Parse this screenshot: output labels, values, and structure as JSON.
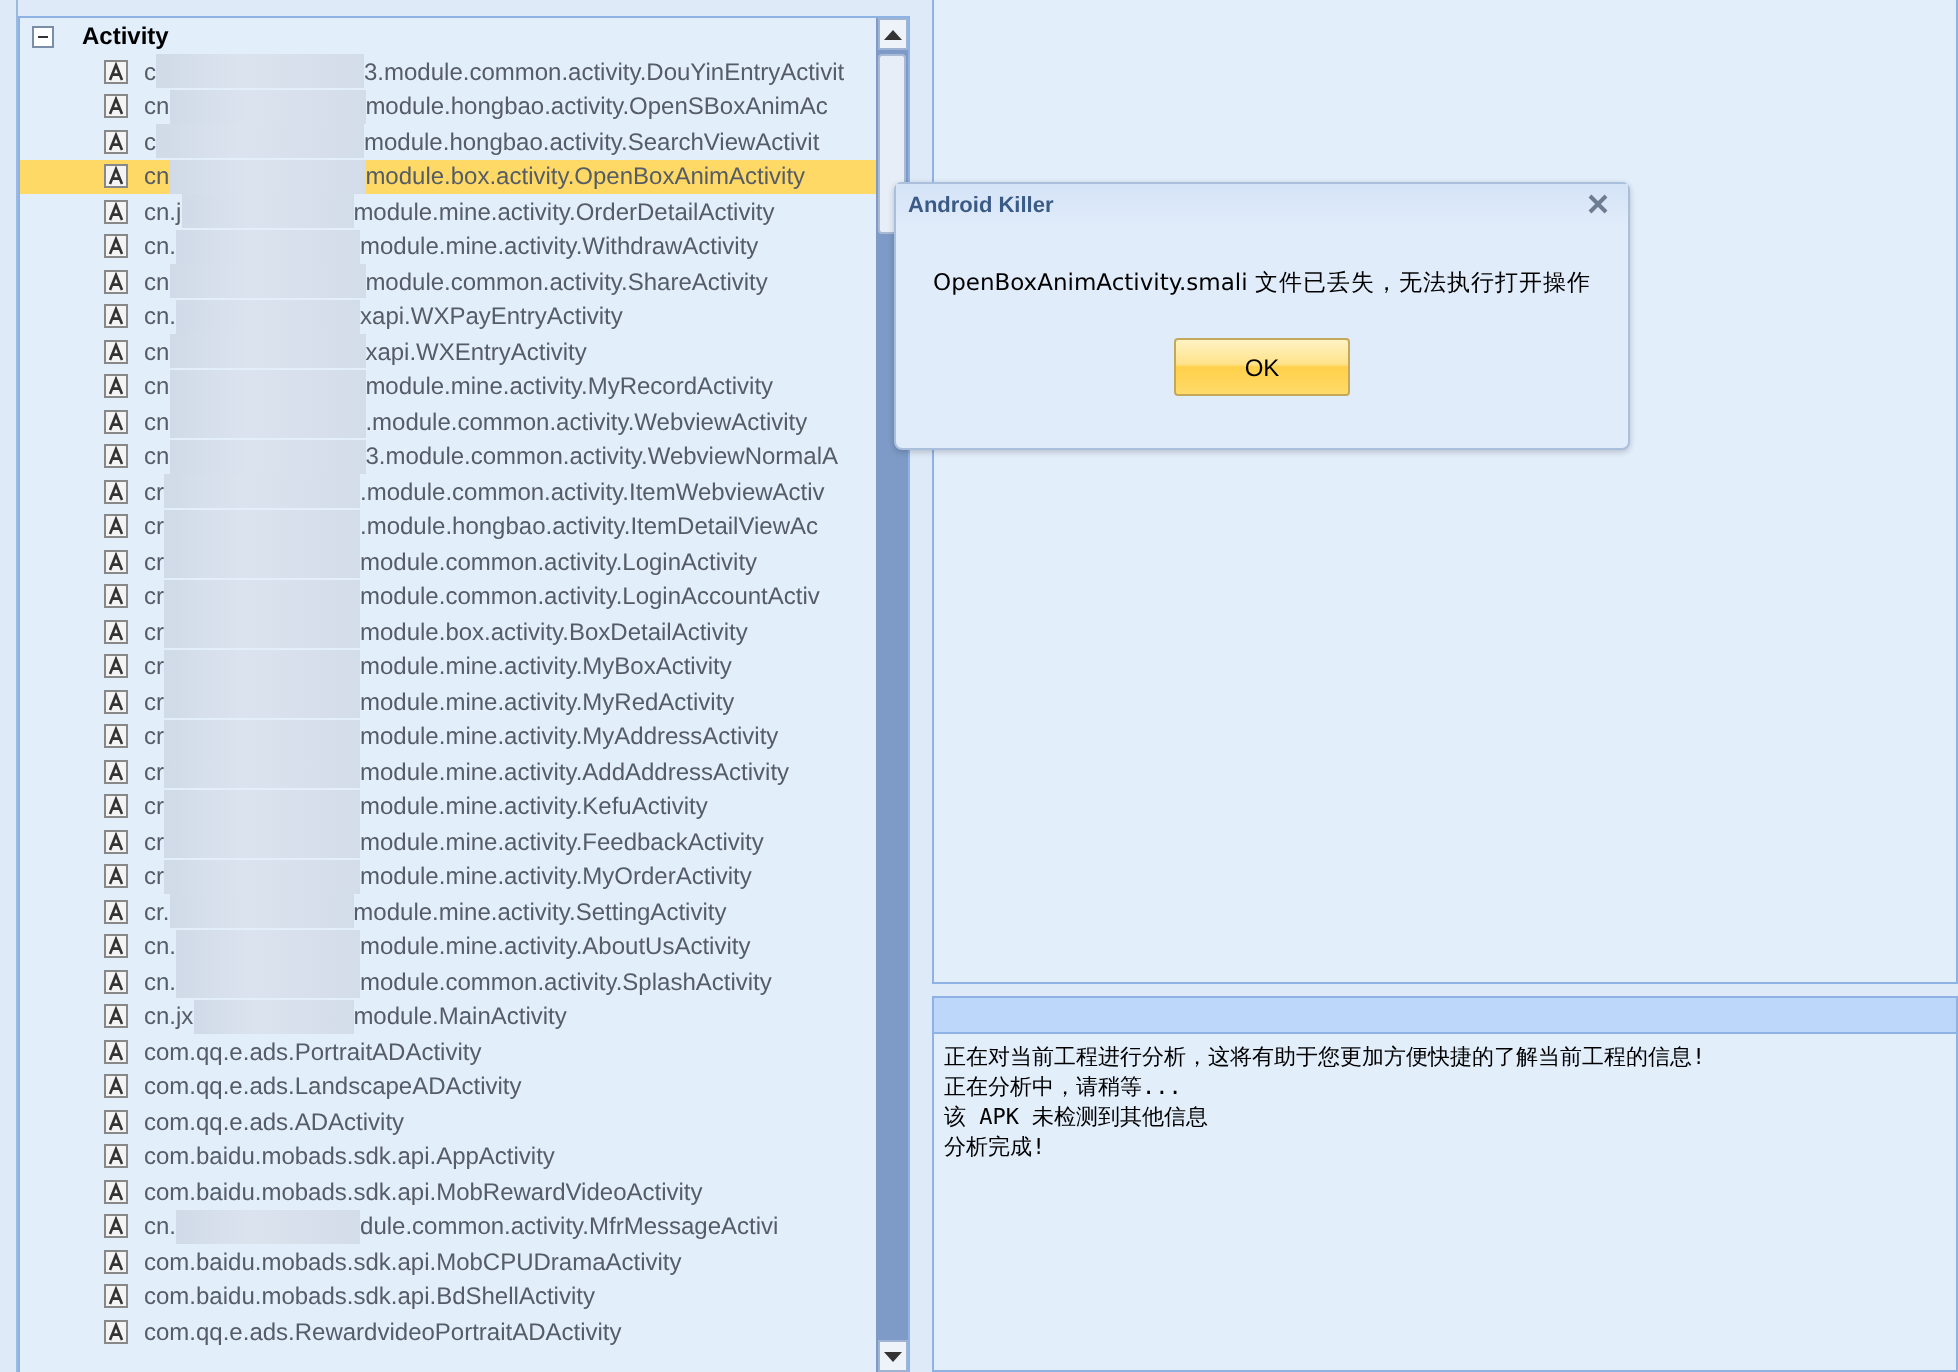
{
  "tree": {
    "root": {
      "label": "Activity",
      "expanded": true
    },
    "items": [
      {
        "prefix": "c",
        "text": "3.module.common.activity.DouYinEntryActivit",
        "selected": false
      },
      {
        "prefix": "cn",
        "text": "module.hongbao.activity.OpenSBoxAnimAc",
        "selected": false
      },
      {
        "prefix": "c",
        "text": "module.hongbao.activity.SearchViewActivit",
        "selected": false
      },
      {
        "prefix": "cn",
        "text": "module.box.activity.OpenBoxAnimActivity",
        "selected": true
      },
      {
        "prefix": "cn.j",
        "text": "module.mine.activity.OrderDetailActivity",
        "selected": false
      },
      {
        "prefix": "cn.",
        "text": "module.mine.activity.WithdrawActivity",
        "selected": false
      },
      {
        "prefix": "cn",
        "text": "module.common.activity.ShareActivity",
        "selected": false
      },
      {
        "prefix": "cn.",
        "text": "xapi.WXPayEntryActivity",
        "selected": false
      },
      {
        "prefix": "cn",
        "text": "xapi.WXEntryActivity",
        "selected": false
      },
      {
        "prefix": "cn",
        "text": "module.mine.activity.MyRecordActivity",
        "selected": false
      },
      {
        "prefix": "cn",
        "text": ".module.common.activity.WebviewActivity",
        "selected": false
      },
      {
        "prefix": "cn",
        "text": "3.module.common.activity.WebviewNormalA",
        "selected": false
      },
      {
        "prefix": "cr",
        "text": ".module.common.activity.ItemWebviewActiv",
        "selected": false
      },
      {
        "prefix": "cr",
        "text": ".module.hongbao.activity.ItemDetailViewAc",
        "selected": false
      },
      {
        "prefix": "cr",
        "text": "module.common.activity.LoginActivity",
        "selected": false
      },
      {
        "prefix": "cr",
        "text": "module.common.activity.LoginAccountActiv",
        "selected": false
      },
      {
        "prefix": "cr",
        "text": "module.box.activity.BoxDetailActivity",
        "selected": false
      },
      {
        "prefix": "cr",
        "text": "module.mine.activity.MyBoxActivity",
        "selected": false
      },
      {
        "prefix": "cr",
        "text": "module.mine.activity.MyRedActivity",
        "selected": false
      },
      {
        "prefix": "cr",
        "text": "module.mine.activity.MyAddressActivity",
        "selected": false
      },
      {
        "prefix": "cr",
        "text": "module.mine.activity.AddAddressActivity",
        "selected": false
      },
      {
        "prefix": "cr",
        "text": "module.mine.activity.KefuActivity",
        "selected": false
      },
      {
        "prefix": "cr",
        "text": "module.mine.activity.FeedbackActivity",
        "selected": false
      },
      {
        "prefix": "cr",
        "text": "module.mine.activity.MyOrderActivity",
        "selected": false
      },
      {
        "prefix": "cr.",
        "text": "module.mine.activity.SettingActivity",
        "selected": false
      },
      {
        "prefix": "cn.",
        "text": "module.mine.activity.AboutUsActivity",
        "selected": false
      },
      {
        "prefix": "cn.",
        "text": "module.common.activity.SplashActivity",
        "selected": false
      },
      {
        "prefix": "cn.jx",
        "text": "module.MainActivity",
        "selected": false
      },
      {
        "text": "com.qq.e.ads.PortraitADActivity",
        "selected": false
      },
      {
        "text": "com.qq.e.ads.LandscapeADActivity",
        "selected": false
      },
      {
        "text": "com.qq.e.ads.ADActivity",
        "selected": false
      },
      {
        "text": "com.baidu.mobads.sdk.api.AppActivity",
        "selected": false
      },
      {
        "text": "com.baidu.mobads.sdk.api.MobRewardVideoActivity",
        "selected": false
      },
      {
        "prefix": "cn.",
        "text": "dule.common.activity.MfrMessageActivi",
        "selected": false
      },
      {
        "text": "com.baidu.mobads.sdk.api.MobCPUDramaActivity",
        "selected": false
      },
      {
        "text": "com.baidu.mobads.sdk.api.BdShellActivity",
        "selected": false
      },
      {
        "text": "com.qq.e.ads.RewardvideoPortraitADActivity",
        "selected": false
      }
    ]
  },
  "log": {
    "lines": [
      "正在对当前工程进行分析，这将有助于您更加方便快捷的了解当前工程的信息!",
      "正在分析中，请稍等...",
      "该 APK 未检测到其他信息",
      "分析完成!"
    ]
  },
  "dialog": {
    "title": "Android Killer",
    "message": "OpenBoxAnimActivity.smali 文件已丢失，无法执行打开操作",
    "button": "OK"
  }
}
